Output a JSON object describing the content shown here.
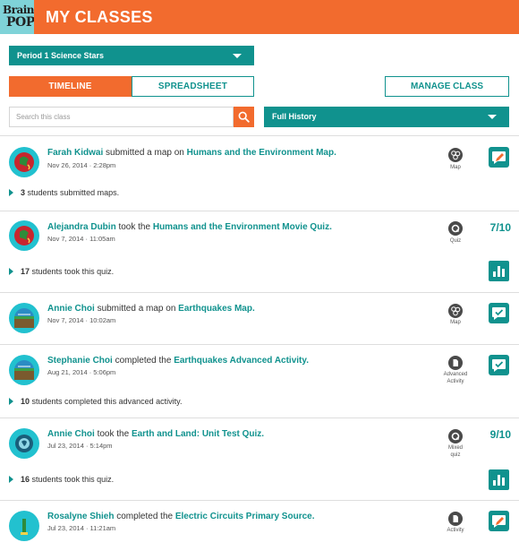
{
  "header": {
    "title": "MY CLASSES",
    "logo_line1": "Brain",
    "logo_line2": "POP"
  },
  "class_select": {
    "value": "Period 1 Science Stars"
  },
  "tabs": [
    {
      "label": "TIMELINE",
      "active": true
    },
    {
      "label": "SPREADSHEET",
      "active": false
    }
  ],
  "manage_label": "MANAGE CLASS",
  "search": {
    "placeholder": "Search this class"
  },
  "history_select": {
    "value": "Full History"
  },
  "colors": {
    "accent_orange": "#f26b2e",
    "accent_teal": "#10928e",
    "avatar_cyan": "#22c1cf"
  },
  "entries": [
    {
      "student": "Farah Kidwai",
      "action": "submitted a map on",
      "item": "Humans and the Environment Map.",
      "timestamp": "Nov 26, 2014 · 2:28pm",
      "type_label": "Map",
      "type_icon": "map-icon",
      "action_icon": "pencil-chat-icon",
      "summary_count": "3",
      "summary_text": "students submitted maps."
    },
    {
      "student": "Alejandra Dubin",
      "action": "took the",
      "item": "Humans and the Environment Movie Quiz.",
      "timestamp": "Nov 7, 2014 · 11:05am",
      "type_label": "Quiz",
      "type_icon": "quiz-icon",
      "score": "7/10",
      "summary_count": "17",
      "summary_text": "students took this quiz."
    },
    {
      "student": "Annie Choi",
      "action": "submitted a map on",
      "item": "Earthquakes Map.",
      "timestamp": "Nov 7, 2014 · 10:02am",
      "type_label": "Map",
      "type_icon": "map-icon",
      "action_icon": "check-chat-icon"
    },
    {
      "student": "Stephanie Choi",
      "action": "completed the",
      "item": "Earthquakes Advanced Activity.",
      "timestamp": "Aug 21, 2014 · 5:06pm",
      "type_label": "Advanced Activity",
      "type_label_line1": "Advanced",
      "type_label_line2": "Activity",
      "type_icon": "activity-icon",
      "action_icon": "check-chat-icon",
      "summary_count": "10",
      "summary_text": "students completed this advanced activity."
    },
    {
      "student": "Annie Choi",
      "action": "took the",
      "item": "Earth and Land: Unit Test Quiz.",
      "timestamp": "Jul 23, 2014 · 5:14pm",
      "type_label": "Mixed quiz",
      "type_label_line1": "Mixed",
      "type_label_line2": "quiz",
      "type_icon": "quiz-icon",
      "score": "9/10",
      "summary_count": "16",
      "summary_text": "students took this quiz."
    },
    {
      "student": "Rosalyne Shieh",
      "action": "completed the",
      "item": "Electric Circuits Primary Source.",
      "timestamp": "Jul 23, 2014 · 11:21am",
      "type_label": "Activity",
      "type_icon": "activity-icon",
      "action_icon": "pencil-chat-icon"
    }
  ]
}
